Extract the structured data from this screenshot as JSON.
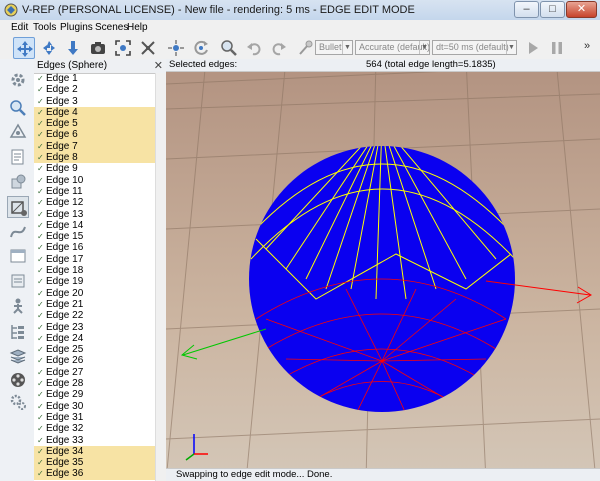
{
  "window": {
    "title": "V-REP (PERSONAL LICENSE) - New file - rendering: 5 ms - EDGE EDIT MODE",
    "minimize": "–",
    "maximize": "□",
    "close": "✕"
  },
  "menu": [
    "Edit",
    "Tools",
    "Plugins",
    "Scenes",
    "Help"
  ],
  "toolbar": {
    "engine": "Bullet",
    "accuracy": "Accurate (default)",
    "timestep": "dt=50 ms (default)",
    "overflow": "»"
  },
  "panel": {
    "title": "Edges (Sphere)",
    "close": "✕",
    "items": [
      {
        "label": "Edge 1",
        "selected": false
      },
      {
        "label": "Edge 2",
        "selected": false
      },
      {
        "label": "Edge 3",
        "selected": false
      },
      {
        "label": "Edge 4",
        "selected": true
      },
      {
        "label": "Edge 5",
        "selected": true
      },
      {
        "label": "Edge 6",
        "selected": true
      },
      {
        "label": "Edge 7",
        "selected": true
      },
      {
        "label": "Edge 8",
        "selected": true
      },
      {
        "label": "Edge 9",
        "selected": false
      },
      {
        "label": "Edge 10",
        "selected": false
      },
      {
        "label": "Edge 11",
        "selected": false
      },
      {
        "label": "Edge 12",
        "selected": false
      },
      {
        "label": "Edge 13",
        "selected": false
      },
      {
        "label": "Edge 14",
        "selected": false
      },
      {
        "label": "Edge 15",
        "selected": false
      },
      {
        "label": "Edge 16",
        "selected": false
      },
      {
        "label": "Edge 17",
        "selected": false
      },
      {
        "label": "Edge 18",
        "selected": false
      },
      {
        "label": "Edge 19",
        "selected": false
      },
      {
        "label": "Edge 20",
        "selected": false
      },
      {
        "label": "Edge 21",
        "selected": false
      },
      {
        "label": "Edge 22",
        "selected": false
      },
      {
        "label": "Edge 23",
        "selected": false
      },
      {
        "label": "Edge 24",
        "selected": false
      },
      {
        "label": "Edge 25",
        "selected": false
      },
      {
        "label": "Edge 26",
        "selected": false
      },
      {
        "label": "Edge 27",
        "selected": false
      },
      {
        "label": "Edge 28",
        "selected": false
      },
      {
        "label": "Edge 29",
        "selected": false
      },
      {
        "label": "Edge 30",
        "selected": false
      },
      {
        "label": "Edge 31",
        "selected": false
      },
      {
        "label": "Edge 32",
        "selected": false
      },
      {
        "label": "Edge 33",
        "selected": false
      },
      {
        "label": "Edge 34",
        "selected": true
      },
      {
        "label": "Edge 35",
        "selected": true
      },
      {
        "label": "Edge 36",
        "selected": true
      }
    ]
  },
  "viewport": {
    "selected_label": "Selected edges:",
    "selected_info": "564 (total edge length=5.1835)",
    "status": "Swapping to edge edit mode... Done."
  },
  "colors": {
    "selection_highlight": "#f7e3a4",
    "mesh_blue": "#0a00f0",
    "edge_yellow": "#ffff00",
    "edge_red": "#ff0000"
  }
}
